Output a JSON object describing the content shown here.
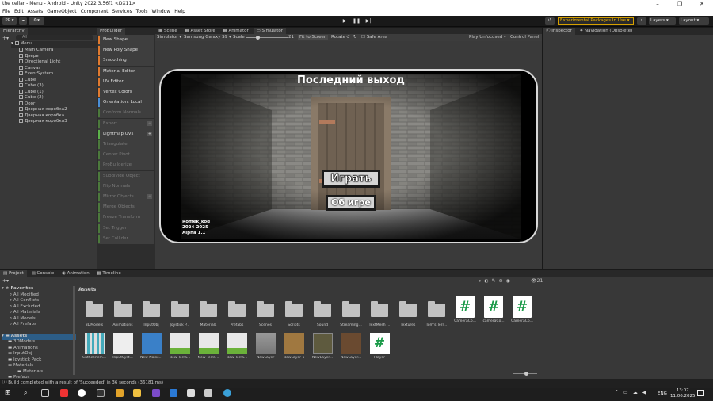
{
  "window": {
    "title": "the cellar - Menu - Android - Unity 2022.3.56f1 <DX11>"
  },
  "menu": [
    "File",
    "Edit",
    "Assets",
    "GameObject",
    "Component",
    "Services",
    "Tools",
    "Window",
    "Help"
  ],
  "toolbar": {
    "account": "PP ▾",
    "experimental": "Experimental Packages In Use ▾",
    "layers": "Layers",
    "layout": "Layout"
  },
  "hierarchy": {
    "tab": "Hierarchy",
    "search_placeholder": "All",
    "scene": "Menu",
    "items": [
      "Main Camera",
      "Дверь",
      "Directional Light",
      "Canvas",
      "EventSystem",
      "Cube",
      "Cube (3)",
      "Cube (1)",
      "Cube (2)",
      "Door",
      "Дверная коробка2",
      "Дверная коробка",
      "Дверная коробка3"
    ]
  },
  "probuilder": {
    "tab": "ProBuilder",
    "items": [
      {
        "label": "New Shape",
        "color": "#e07a2f",
        "enabled": true
      },
      {
        "label": "New Poly Shape",
        "color": "#e07a2f",
        "enabled": true
      },
      {
        "label": "Smoothing",
        "color": "#e07a2f",
        "enabled": true
      },
      {
        "label": "Material Editor",
        "color": "#e07a2f",
        "enabled": true
      },
      {
        "label": "UV Editor",
        "color": "#e07a2f",
        "enabled": true
      },
      {
        "label": "Vertex Colors",
        "color": "#e07a2f",
        "enabled": true
      },
      {
        "label": "Orientation: Local",
        "color": "#4a8fd8",
        "enabled": true
      },
      {
        "label": "Conform Normals",
        "color": "#4c7a3c",
        "enabled": false
      },
      {
        "label": "Export",
        "color": "#4c7a3c",
        "enabled": false
      },
      {
        "label": "Lightmap UVs",
        "color": "#5cb24a",
        "enabled": true
      },
      {
        "label": "Triangulate",
        "color": "#4c7a3c",
        "enabled": false
      },
      {
        "label": "Center Pivot",
        "color": "#4c7a3c",
        "enabled": false
      },
      {
        "label": "ProBuilderize",
        "color": "#4c7a3c",
        "enabled": false
      },
      {
        "label": "Subdivide Object",
        "color": "#4c7a3c",
        "enabled": false
      },
      {
        "label": "Flip Normals",
        "color": "#4c7a3c",
        "enabled": false
      },
      {
        "label": "Mirror Objects",
        "color": "#4c7a3c",
        "enabled": false
      },
      {
        "label": "Merge Objects",
        "color": "#4c7a3c",
        "enabled": false
      },
      {
        "label": "Freeze Transform",
        "color": "#4c7a3c",
        "enabled": false
      },
      {
        "label": "Set Trigger",
        "color": "#4c7a3c",
        "enabled": false
      },
      {
        "label": "Set Collider",
        "color": "#4c7a3c",
        "enabled": false
      }
    ]
  },
  "scene_tabs": [
    "Scene",
    "Asset Store",
    "Animator",
    "Simulator"
  ],
  "simulator": {
    "mode": "Simulator ▾",
    "device": "Samsung Galaxy S9 ▾",
    "scale_label": "Scale",
    "scale_value": "21",
    "fit": "Fit to Screen",
    "rotate": "Rotate",
    "safe_area": "Safe Area",
    "focus": "Play Unfocused ▾",
    "control": "Control Panel"
  },
  "game": {
    "title": "Последний выход",
    "play": "Играть",
    "about": "Об игре",
    "credits": [
      "Romek_kod",
      "2024-2025",
      "Alpha 1.1"
    ]
  },
  "inspector": {
    "tab1": "Inspector",
    "tab2": "Navigation (Obsolete)"
  },
  "bottom_tabs": [
    "Project",
    "Console",
    "Animation",
    "Timeline"
  ],
  "project": {
    "count": "21",
    "assets_label": "Assets",
    "favorites": {
      "label": "Favorites",
      "items": [
        "All Modified",
        "All Conflicts",
        "All Excluded",
        "All Materials",
        "All Models",
        "All Prefabs"
      ]
    },
    "tree": {
      "label": "Assets",
      "items": [
        "3DModels",
        "Animations",
        "InputObj",
        "Joystick Pack",
        "Materials",
        "Materials",
        "Prefabs"
      ]
    },
    "row1": [
      "3DModels",
      "Animations",
      "InputObj",
      "Joystick P...",
      "Materials",
      "Prefabs",
      "Scenes",
      "Scripts",
      "Sound",
      "Streaming...",
      "TextMesh ...",
      "Textures",
      "Tom's Terr...",
      "CameraCo...",
      "cameraCo...",
      "CameraCo..."
    ],
    "row2": [
      "CutSceneIn...",
      "InputSyst...",
      "New Noise...",
      "New Terra...",
      "New Terra...",
      "New Terra...",
      "NewLayer",
      "NewLayer 1",
      "NewLayer...",
      "NewLayer...",
      "Player"
    ]
  },
  "status": "Build completed with a result of 'Succeeded' in 36 seconds (36181 ms)",
  "taskbar": {
    "lang": "ENG",
    "time": "13:07",
    "date": "11.06.2025"
  }
}
